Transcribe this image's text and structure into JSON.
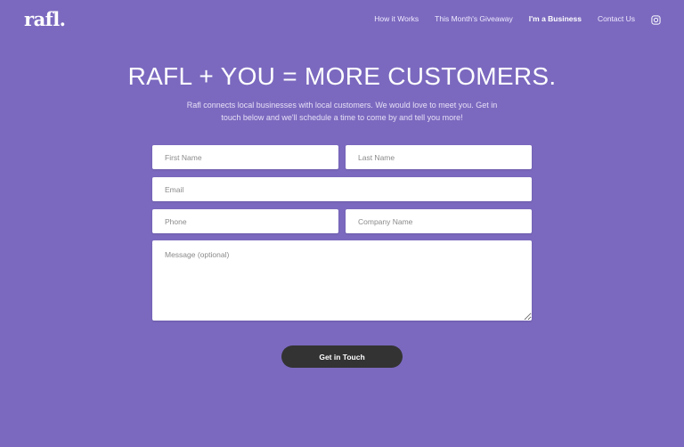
{
  "brand": {
    "logo": "rafl."
  },
  "nav": {
    "items": [
      {
        "label": "How it Works"
      },
      {
        "label": "This Month's Giveaway"
      },
      {
        "label": "I'm a Business",
        "active": true
      },
      {
        "label": "Contact Us"
      }
    ],
    "social_icon": "instagram-icon"
  },
  "hero": {
    "title": "RAFL + YOU = MORE CUSTOMERS.",
    "subtitle": "Rafl connects local businesses with local customers. We would love to meet you. Get in touch below and we'll schedule a time to come by and tell you more!"
  },
  "form": {
    "first_name": {
      "value": "",
      "placeholder": "First Name"
    },
    "last_name": {
      "value": "",
      "placeholder": "Last Name"
    },
    "email": {
      "value": "",
      "placeholder": "Email"
    },
    "phone": {
      "value": "",
      "placeholder": "Phone"
    },
    "company": {
      "value": "",
      "placeholder": "Company Name"
    },
    "message": {
      "value": "",
      "placeholder": "Message (optional)"
    },
    "submit_label": "Get in Touch"
  },
  "colors": {
    "background": "#7b69bf",
    "button": "#333333",
    "field": "#ffffff"
  }
}
